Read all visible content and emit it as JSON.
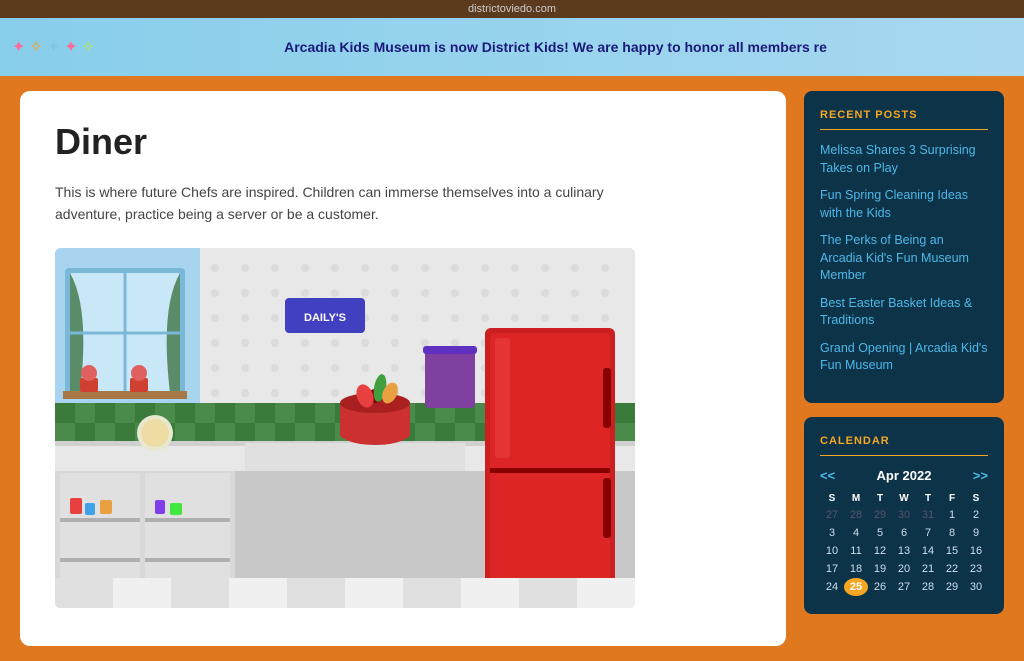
{
  "topbar": {
    "url": "districtoviedo.com"
  },
  "banner": {
    "text": "Arcadia Kids Museum is now District Kids! We are happy to honor all members re",
    "decorations": [
      "✦",
      "✧",
      "✦",
      "✦",
      "✧"
    ]
  },
  "main": {
    "title": "Diner",
    "description": "This is where future Chefs are inspired. Children can immerse themselves into a culinary adventure, practice being a server or be a customer."
  },
  "sidebar": {
    "recent_posts_title": "RECENT POSTS",
    "posts": [
      {
        "label": "Melissa Shares 3 Surprising Takes on Play"
      },
      {
        "label": "Fun Spring Cleaning Ideas with the Kids"
      },
      {
        "label": "The Perks of Being an Arcadia Kid's Fun Museum Member"
      },
      {
        "label": "Best Easter Basket Ideas & Traditions"
      },
      {
        "label": "Grand Opening | Arcadia Kid's Fun Museum"
      }
    ],
    "calendar_title": "CALENDAR",
    "calendar": {
      "month": "Apr 2022",
      "nav_prev": "<<",
      "nav_next": ">>",
      "days_of_week": [
        "S",
        "M",
        "T",
        "W",
        "T",
        "F",
        "S"
      ],
      "weeks": [
        [
          "27",
          "28",
          "29",
          "30",
          "31",
          "1",
          "2"
        ],
        [
          "3",
          "4",
          "5",
          "6",
          "7",
          "8",
          "9"
        ],
        [
          "10",
          "11",
          "12",
          "13",
          "14",
          "15",
          "16"
        ],
        [
          "17",
          "18",
          "19",
          "20",
          "21",
          "22",
          "23"
        ],
        [
          "24",
          "25",
          "26",
          "27",
          "28",
          "29",
          "30"
        ]
      ],
      "today": "25",
      "empty_prev": [
        "27",
        "28",
        "29",
        "30",
        "31"
      ]
    }
  }
}
